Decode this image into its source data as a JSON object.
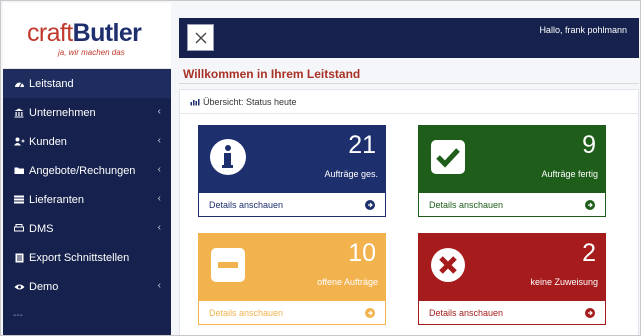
{
  "brand": {
    "name_part1": "craft",
    "name_part2": "Butler",
    "slogan": "ja, wir machen das"
  },
  "sidebar": {
    "items": [
      {
        "label": "Leitstand",
        "icon": "dashboard-icon",
        "has_chevron": false
      },
      {
        "label": "Unternehmen",
        "icon": "bank-icon",
        "has_chevron": true
      },
      {
        "label": "Kunden",
        "icon": "users-icon",
        "has_chevron": true
      },
      {
        "label": "Angebote/Rechungen",
        "icon": "folder-icon",
        "has_chevron": true
      },
      {
        "label": "Lieferanten",
        "icon": "list-icon",
        "has_chevron": true
      },
      {
        "label": "DMS",
        "icon": "printer-icon",
        "has_chevron": true
      },
      {
        "label": "Export Schnittstellen",
        "icon": "export-icon",
        "has_chevron": false
      },
      {
        "label": "Demo",
        "icon": "eye-icon",
        "has_chevron": true
      }
    ],
    "separator": "---"
  },
  "topbar": {
    "greeting": "Hallo, frank pohlmann"
  },
  "page_title": "Willkommen in Ihrem Leitstand",
  "panel": {
    "title": "Übersicht: Status heute"
  },
  "cards": [
    {
      "value": "21",
      "label": "Aufträge ges.",
      "link": "Details anschauen",
      "color": "#1e2f6e",
      "icon": "info-icon"
    },
    {
      "value": "9",
      "label": "Aufträge fertig",
      "link": "Details anschauen",
      "color": "#1e5e1a",
      "icon": "check-icon"
    },
    {
      "value": "10",
      "label": "offene Aufträge",
      "link": "Details anschauen",
      "color": "#f2b34f",
      "icon": "minus-icon"
    },
    {
      "value": "2",
      "label": "keine Zuweisung",
      "link": "Details anschauen",
      "color": "#a61b1b",
      "icon": "x-circle-icon"
    }
  ],
  "colors": {
    "sidebar_bg": "#16224d",
    "title_red": "#a93226"
  }
}
